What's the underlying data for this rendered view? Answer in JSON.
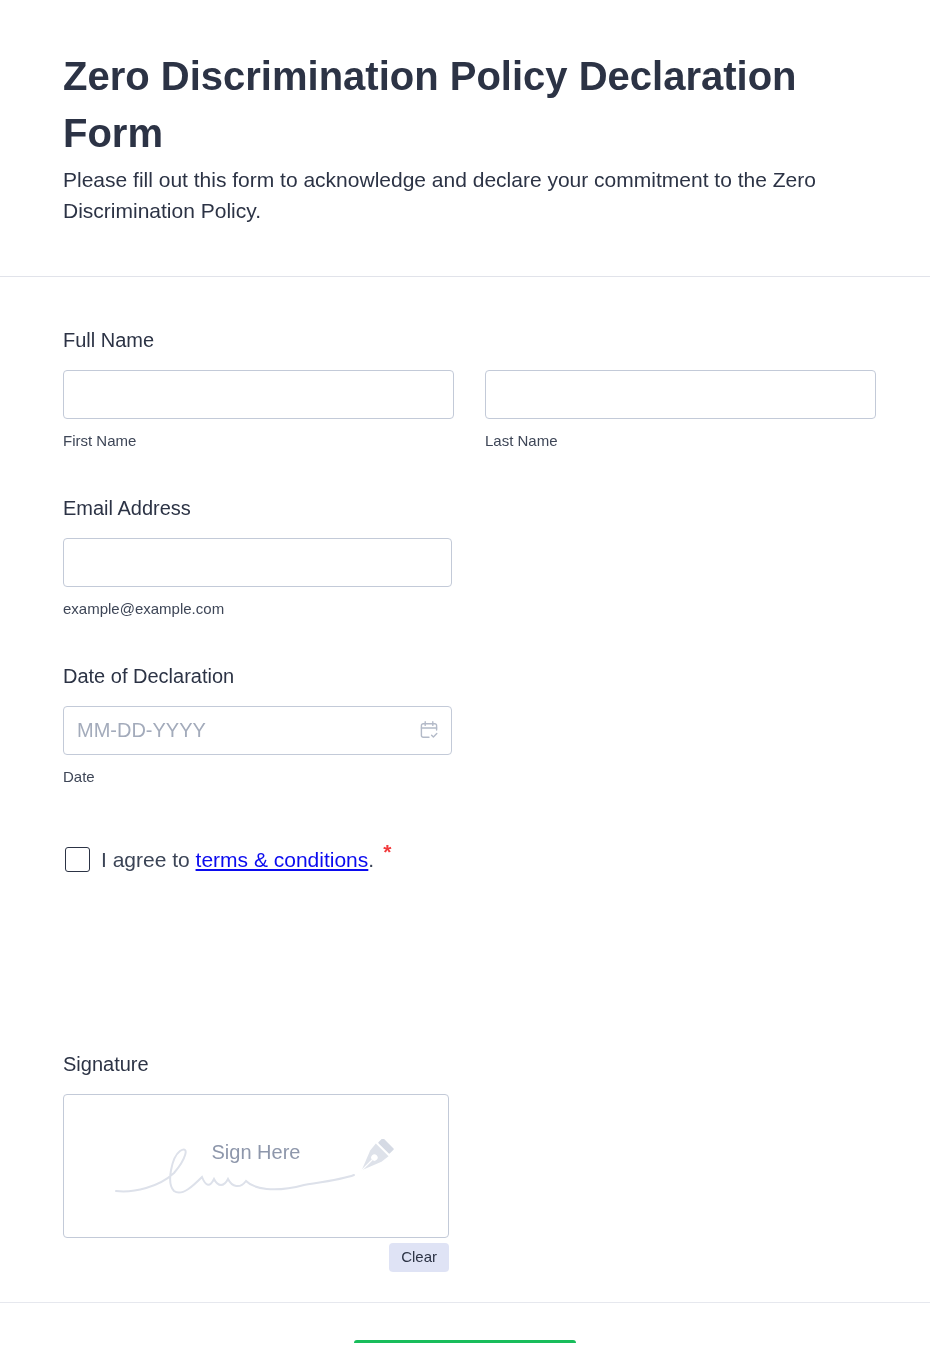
{
  "header": {
    "title": "Zero Discrimination Policy Declaration Form",
    "description": "Please fill out this form to acknowledge and declare your commitment to the Zero Discrimination Policy."
  },
  "fields": [
    {
      "kind": "name",
      "label": "Full Name",
      "inputs": [
        {
          "sublabel": "First Name"
        },
        {
          "sublabel": "Last Name"
        }
      ]
    },
    {
      "kind": "email",
      "label": "Email Address",
      "sublabel": "example@example.com"
    },
    {
      "kind": "date",
      "label": "Date of Declaration",
      "placeholder": "MM-DD-YYYY",
      "sublabel": "Date"
    },
    {
      "kind": "checkbox",
      "checked": false,
      "text": "I agree to ",
      "link": "terms & conditions",
      "after": ".",
      "required_mark": "*"
    },
    {
      "kind": "signature",
      "label": "Signature",
      "placeholder": "Sign Here",
      "clear_button": "Clear"
    }
  ]
}
